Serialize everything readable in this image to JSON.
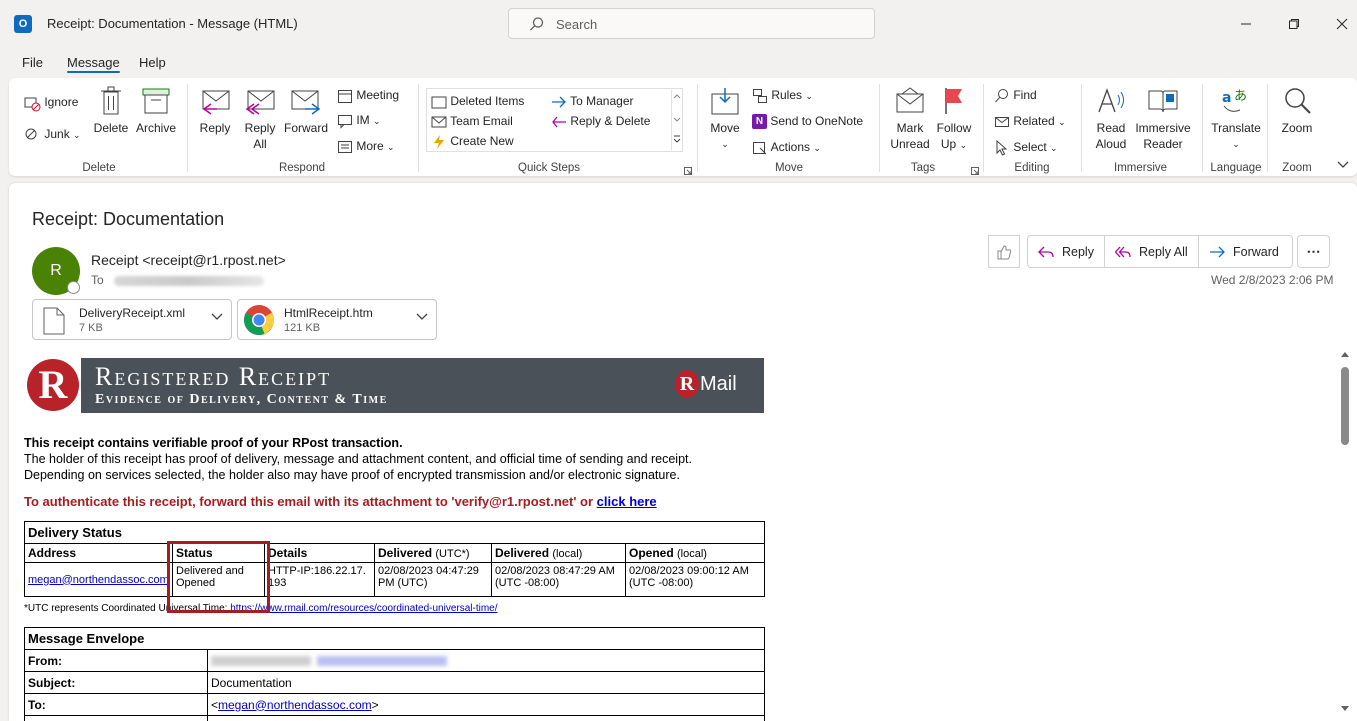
{
  "window": {
    "title": "Receipt: Documentation  -  Message (HTML)",
    "app_icon": "O"
  },
  "search": {
    "placeholder": "Search"
  },
  "menu": {
    "tabs": [
      {
        "label": "File"
      },
      {
        "label": "Message"
      },
      {
        "label": "Help"
      }
    ]
  },
  "ribbon": {
    "delete": {
      "ignore": "Ignore",
      "junk": "Junk",
      "delete": "Delete",
      "archive": "Archive",
      "group": "Delete"
    },
    "respond": {
      "reply": "Reply",
      "reply_all_1": "Reply",
      "reply_all_2": "All",
      "forward": "Forward",
      "meeting": "Meeting",
      "im": "IM",
      "more": "More",
      "group": "Respond"
    },
    "quick_steps": {
      "items": [
        "Deleted Items",
        "Team Email",
        "Create New",
        "To Manager",
        "Reply & Delete"
      ],
      "group": "Quick Steps"
    },
    "move": {
      "move": "Move",
      "rules": "Rules",
      "onenote": "Send to OneNote",
      "actions": "Actions",
      "group": "Move"
    },
    "tags": {
      "mark_1": "Mark",
      "mark_2": "Unread",
      "follow_1": "Follow",
      "follow_2": "Up",
      "group": "Tags"
    },
    "editing": {
      "find": "Find",
      "related": "Related",
      "select": "Select",
      "group": "Editing"
    },
    "immersive": {
      "read_1": "Read",
      "read_2": "Aloud",
      "reader_1": "Immersive",
      "reader_2": "Reader",
      "group": "Immersive"
    },
    "language": {
      "translate": "Translate",
      "group": "Language"
    },
    "zoom": {
      "zoom": "Zoom",
      "group": "Zoom"
    }
  },
  "message": {
    "subject": "Receipt: Documentation",
    "avatar_initial": "R",
    "sender": "Receipt <receipt@r1.rpost.net>",
    "to_label": "To",
    "date": "Wed 2/8/2023 2:06 PM",
    "actions": {
      "reply": "Reply",
      "reply_all": "Reply All",
      "forward": "Forward"
    },
    "attachments": [
      {
        "name": "DeliveryReceipt.xml",
        "size": "7 KB"
      },
      {
        "name": "HtmlReceipt.htm",
        "size": "121 KB"
      }
    ]
  },
  "body": {
    "banner_title": "Registered Receipt",
    "banner_subtitle": "Evidence of Delivery, Content & Time",
    "banner_logo": "R",
    "banner_brand": "Mail",
    "banner_brand_r": "R",
    "intro_bold": "This receipt contains verifiable proof of your RPost transaction.",
    "intro_1": "The holder of this receipt has proof of delivery, message and attachment content, and official time of sending and receipt.",
    "intro_2": "Depending on services selected, the holder also may have proof of encrypted transmission and/or electronic signature.",
    "authenticate": "To authenticate this receipt, forward this email with its attachment to 'verify@r1.rpost.net' or ",
    "click_here": "click here",
    "delivery_status": {
      "caption": "Delivery Status",
      "headers": {
        "address": "Address",
        "status": "Status",
        "details": "Details",
        "delivered_utc": "Delivered",
        "delivered_utc_sub": "(UTC*)",
        "delivered_local": "Delivered",
        "delivered_local_sub": "(local)",
        "opened": "Opened",
        "opened_sub": "(local)"
      },
      "row": {
        "address": "megan@northendassoc.com",
        "status": "Delivered and Opened",
        "details": "HTTP-IP:186.22.17.193",
        "delivered_utc": "02/08/2023 04:47:29 PM (UTC)",
        "delivered_local": "02/08/2023 08:47:29 AM (UTC -08:00)",
        "opened": "02/08/2023 09:00:12 AM (UTC -08:00)"
      }
    },
    "utc_note": "*UTC represents Coordinated Universal Time: ",
    "utc_link": "https://www.rmail.com/resources/coordinated-universal-time/",
    "envelope": {
      "caption": "Message Envelope",
      "from_label": "From:",
      "subject_label": "Subject:",
      "subject_value": "Documentation",
      "to_label": "To:",
      "to_lt": "<",
      "to_value": "megan@northendassoc.com",
      "to_gt": ">"
    }
  }
}
